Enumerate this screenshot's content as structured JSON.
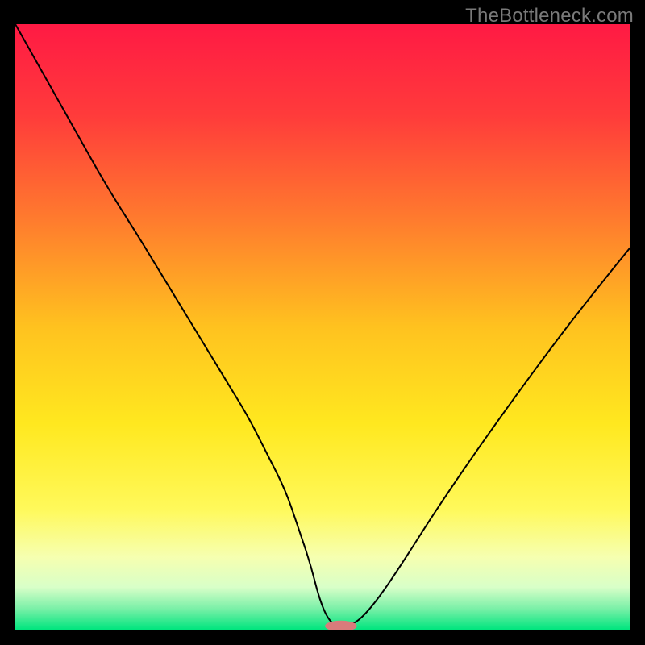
{
  "watermark": "TheBottleneck.com",
  "chart_data": {
    "type": "line",
    "title": "",
    "xlabel": "",
    "ylabel": "",
    "xlim": [
      0,
      100
    ],
    "ylim": [
      0,
      100
    ],
    "background_gradient": {
      "stops": [
        {
          "offset": 0.0,
          "color": "#ff1a44"
        },
        {
          "offset": 0.15,
          "color": "#ff3b3b"
        },
        {
          "offset": 0.32,
          "color": "#ff7a2e"
        },
        {
          "offset": 0.5,
          "color": "#ffc21f"
        },
        {
          "offset": 0.66,
          "color": "#ffe81f"
        },
        {
          "offset": 0.8,
          "color": "#fff95a"
        },
        {
          "offset": 0.88,
          "color": "#f6ffb0"
        },
        {
          "offset": 0.93,
          "color": "#d8ffc8"
        },
        {
          "offset": 0.965,
          "color": "#7bf0a8"
        },
        {
          "offset": 1.0,
          "color": "#00e57e"
        }
      ]
    },
    "series": [
      {
        "name": "bottleneck-curve",
        "stroke": "#000000",
        "stroke_width": 2,
        "x": [
          0,
          5,
          10,
          15,
          20,
          23,
          26,
          29,
          32,
          35,
          38,
          41,
          44,
          46,
          48,
          49.5,
          51,
          52.5,
          54,
          56,
          59,
          63,
          68,
          74,
          81,
          89,
          96,
          100
        ],
        "y": [
          100,
          91,
          82,
          73,
          65,
          60,
          55,
          50,
          45,
          40,
          35,
          29,
          23,
          17,
          11,
          5,
          1.5,
          0.6,
          0.6,
          1.5,
          5,
          11,
          19,
          28,
          38,
          49,
          58,
          63
        ]
      }
    ],
    "marker": {
      "name": "bottleneck-marker",
      "x": 53,
      "y": 0.6,
      "rx": 2.6,
      "ry": 0.9,
      "fill": "#d97b7b"
    }
  }
}
